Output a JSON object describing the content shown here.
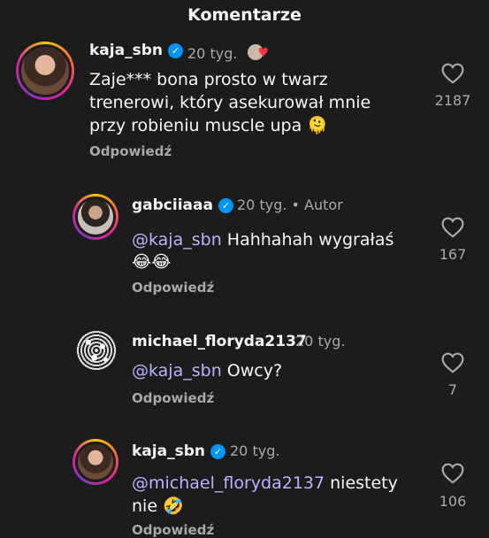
{
  "header": {
    "title": "Komentarze"
  },
  "comments": [
    {
      "username": "kaja_sbn",
      "verified": true,
      "time": "20 tyg.",
      "text": "Zaje*** bona prosto w twarz trenerowi, który asekurował mnie przy robieniu muscle upa 🫠",
      "reply_label": "Odpowiedź",
      "like_count": "2187",
      "sticker": "avatar-heart-sticker"
    },
    {
      "username": "gabciiaaa",
      "verified": true,
      "time": "20 tyg.",
      "author_badge": "• Autor",
      "mention": "@kaja_sbn",
      "text": " Hahhahah wygrałaś",
      "emoji_line": "😂😂",
      "reply_label": "Odpowiedź",
      "like_count": "167"
    },
    {
      "username": "michael_floryda2137",
      "verified": false,
      "time": "20 tyg.",
      "mention": "@kaja_sbn",
      "text": " Owcy?",
      "reply_label": "Odpowiedź",
      "like_count": "7"
    },
    {
      "username": "kaja_sbn",
      "verified": true,
      "time": "20 tyg.",
      "mention": "@michael_floryda2137",
      "text": " niestety nie 🤣",
      "reply_label": "Odpowiedź",
      "like_count": "106"
    }
  ],
  "colors": {
    "background": "#1c1c1c",
    "verified": "#0095f6",
    "mention": "#b9b3ff",
    "secondary_text": "#a8a8a8"
  }
}
